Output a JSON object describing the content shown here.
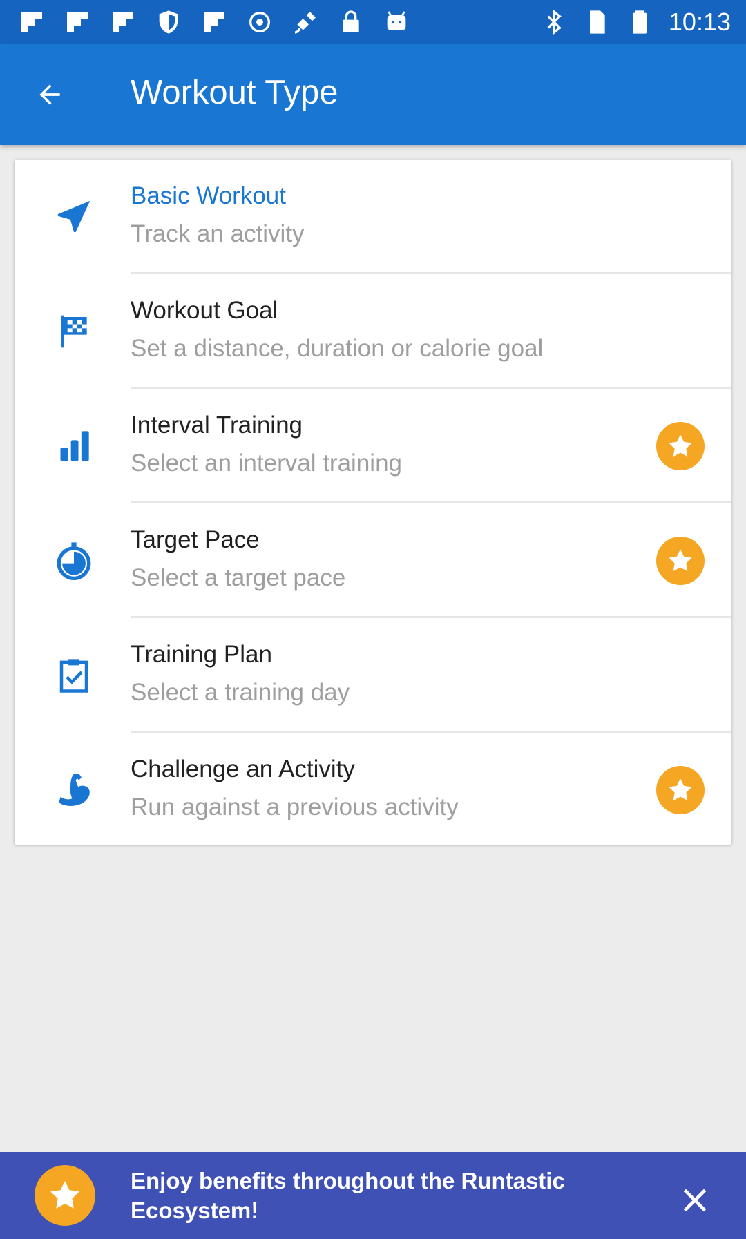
{
  "status_bar": {
    "time": "10:13",
    "left_icons": [
      "flipboard-icon",
      "flipboard-icon",
      "flipboard-icon",
      "shield-icon",
      "flipboard-icon",
      "sync-icon",
      "fake-gps-icon",
      "lock-icon",
      "android-icon"
    ],
    "right_icons": [
      "bluetooth-icon",
      "sim-card-icon",
      "battery-icon"
    ]
  },
  "app_bar": {
    "title": "Workout Type",
    "back_icon": "arrow-back-icon",
    "background": "#1976d2"
  },
  "workout_types": [
    {
      "title": "Basic Workout",
      "subtitle": "Track an activity",
      "icon": "navigation-arrow-icon",
      "active": true,
      "premium": false
    },
    {
      "title": "Workout Goal",
      "subtitle": "Set a distance, duration or calorie goal",
      "icon": "checkered-flag-icon",
      "active": false,
      "premium": false
    },
    {
      "title": "Interval Training",
      "subtitle": "Select an interval training",
      "icon": "bar-chart-icon",
      "active": false,
      "premium": true
    },
    {
      "title": "Target Pace",
      "subtitle": "Select a target pace",
      "icon": "stopwatch-icon",
      "active": false,
      "premium": true
    },
    {
      "title": "Training Plan",
      "subtitle": "Select a training day",
      "icon": "clipboard-check-icon",
      "active": false,
      "premium": false
    },
    {
      "title": "Challenge an Activity",
      "subtitle": "Run against a previous activity",
      "icon": "flexed-bicep-icon",
      "active": false,
      "premium": true
    }
  ],
  "promo": {
    "text": "Enjoy benefits throughout the Runtastic Ecosystem!",
    "icon": "star-icon",
    "close_icon": "close-icon",
    "background": "#3f51b5"
  },
  "colors": {
    "accent": "#1976d2",
    "premium": "#f5a623",
    "subtitle": "#9e9e9e"
  }
}
